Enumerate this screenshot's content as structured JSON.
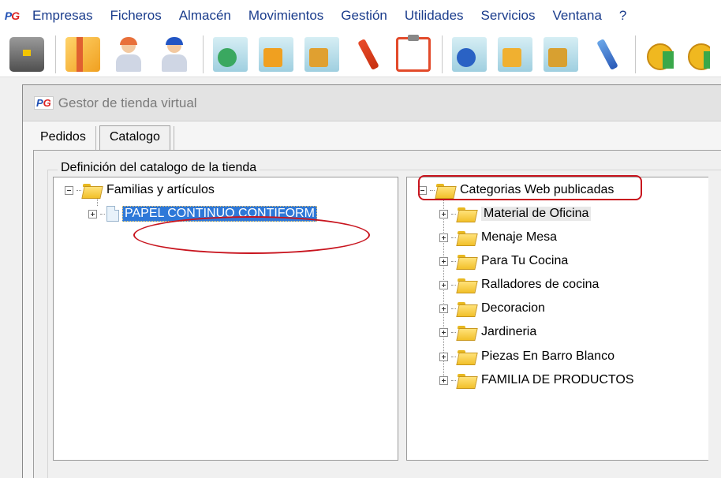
{
  "menubar": {
    "logo": "PG",
    "items": [
      "Empresas",
      "Ficheros",
      "Almacén",
      "Movimientos",
      "Gestión",
      "Utilidades",
      "Servicios",
      "Ventana",
      "?"
    ]
  },
  "toolbar": {
    "icons": [
      "briefcase-icon",
      "box-icon",
      "customer-icon",
      "supplier-icon",
      "order-check-icon",
      "delivery-note-icon",
      "invoice-check-icon",
      "pen-icon",
      "clipboard-icon",
      "purchase-check-icon",
      "purchase-box-icon",
      "purchase-delivery-icon",
      "blue-pen-icon",
      "coins-up-icon",
      "coins-icon"
    ]
  },
  "window": {
    "logo": "PG",
    "title": "Gestor de tienda virtual",
    "tabs": [
      {
        "label": "Pedidos"
      },
      {
        "label": "Catalogo"
      }
    ],
    "group_title": "Definición del catalogo de la tienda",
    "left_tree": {
      "root": "Familias y artículos",
      "children": [
        {
          "label": "PAPEL CONTINUO CONTIFORM",
          "selected": true
        }
      ]
    },
    "right_tree": {
      "root": "Categorias Web publicadas",
      "children": [
        {
          "label": "Material de Oficina"
        },
        {
          "label": "Menaje Mesa"
        },
        {
          "label": "Para Tu Cocina"
        },
        {
          "label": "Ralladores de cocina"
        },
        {
          "label": "Decoracion"
        },
        {
          "label": "Jardineria"
        },
        {
          "label": "Piezas En Barro Blanco"
        },
        {
          "label": "FAMILIA DE PRODUCTOS"
        }
      ]
    }
  },
  "annotation_color": "#c8141e"
}
